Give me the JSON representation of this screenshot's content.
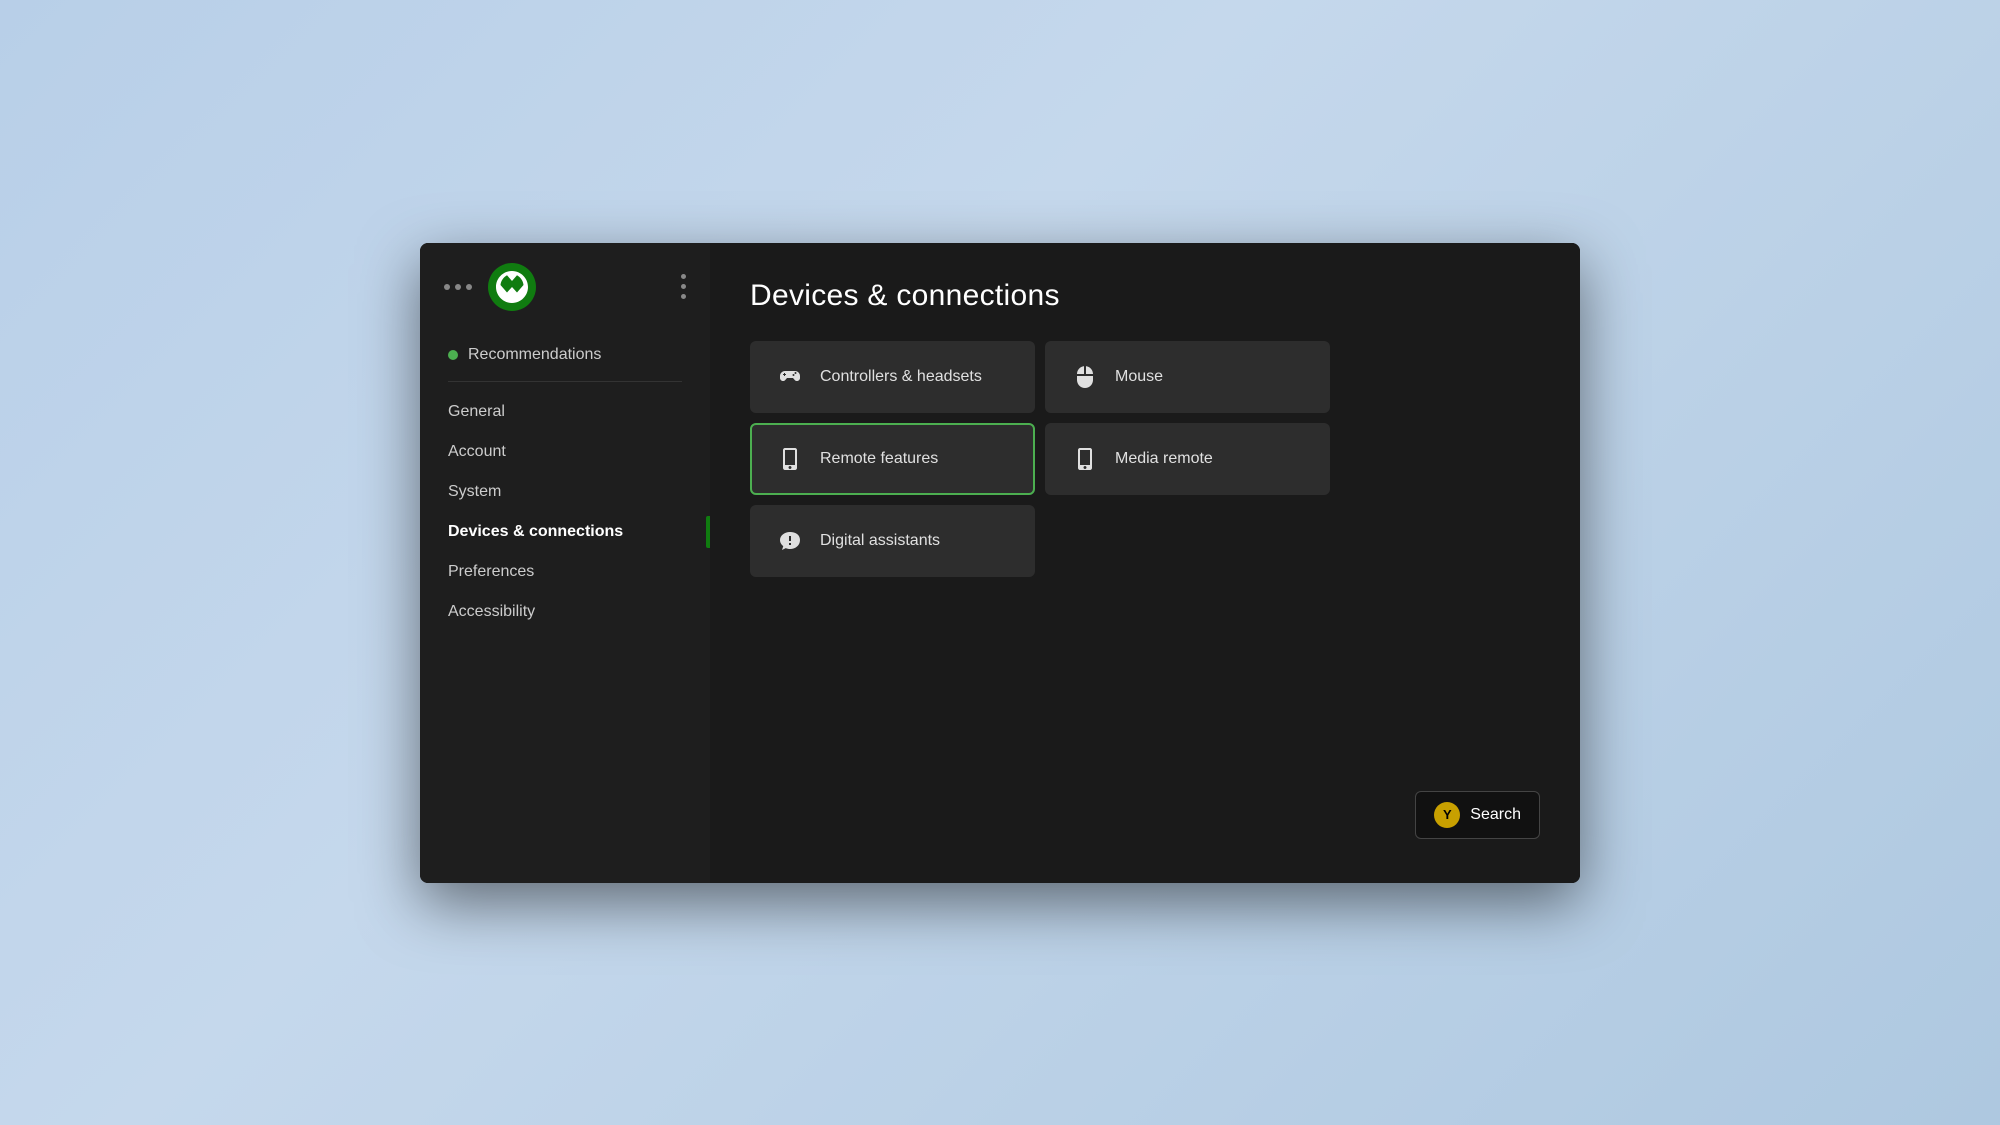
{
  "sidebar": {
    "nav_items": [
      {
        "id": "recommendations",
        "label": "Recommendations",
        "has_dot": true,
        "active": false,
        "separator_after": true
      },
      {
        "id": "general",
        "label": "General",
        "has_dot": false,
        "active": false
      },
      {
        "id": "account",
        "label": "Account",
        "has_dot": false,
        "active": false
      },
      {
        "id": "system",
        "label": "System",
        "has_dot": false,
        "active": false
      },
      {
        "id": "devices",
        "label": "Devices & connections",
        "has_dot": false,
        "active": true
      },
      {
        "id": "preferences",
        "label": "Preferences",
        "has_dot": false,
        "active": false
      },
      {
        "id": "accessibility",
        "label": "Accessibility",
        "has_dot": false,
        "active": false
      }
    ]
  },
  "main": {
    "page_title": "Devices & connections",
    "grid_items": [
      {
        "id": "controllers",
        "label": "Controllers & headsets",
        "icon": "controller",
        "focused": false,
        "col_span": false
      },
      {
        "id": "mouse",
        "label": "Mouse",
        "icon": "mouse",
        "focused": false,
        "col_span": false
      },
      {
        "id": "remote_features",
        "label": "Remote features",
        "icon": "remote",
        "focused": true,
        "col_span": false
      },
      {
        "id": "media_remote",
        "label": "Media remote",
        "icon": "media_remote",
        "focused": false,
        "col_span": false
      },
      {
        "id": "digital_assistants",
        "label": "Digital assistants",
        "icon": "assistant",
        "focused": false,
        "col_span": false
      }
    ]
  },
  "search_button": {
    "y_label": "Y",
    "label": "Search"
  }
}
